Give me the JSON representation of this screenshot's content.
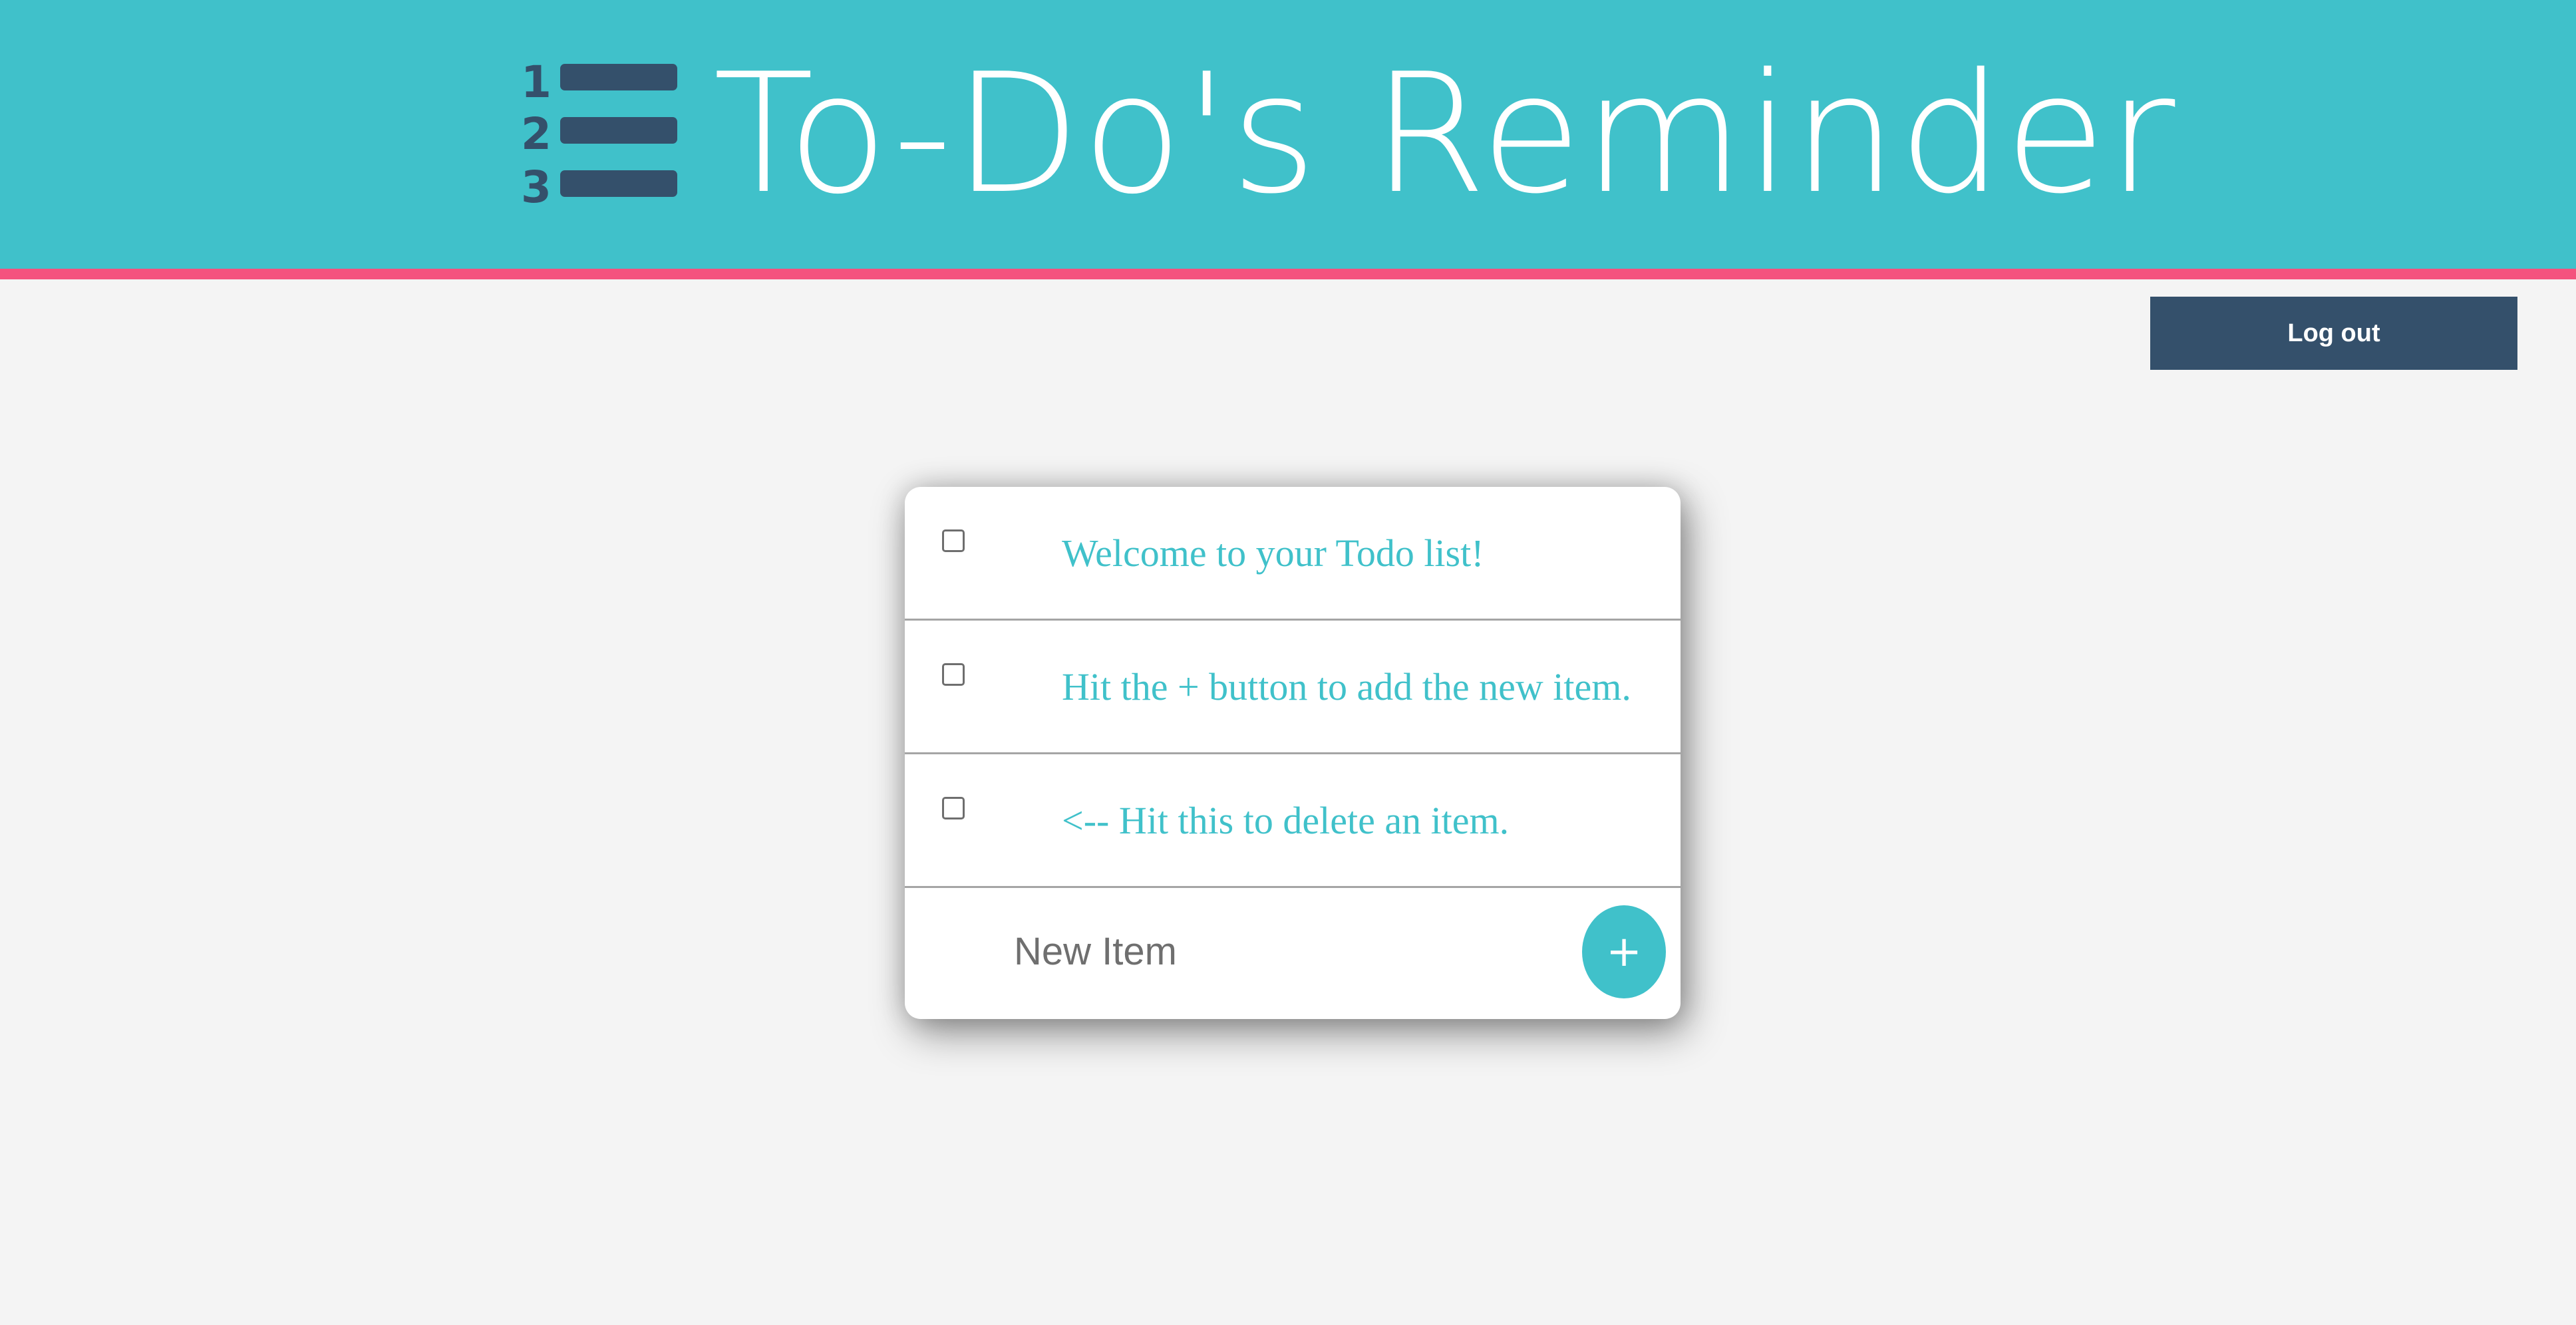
{
  "colors": {
    "header_bg": "#40c1ca",
    "header_border": "#f4527e",
    "page_bg": "#f4f4f4",
    "logout_bg": "#34506b",
    "accent": "#40c1ca",
    "logo_dark": "#34506b"
  },
  "header": {
    "logo_icon": "numbered-list-icon",
    "logo_numbers": [
      "1",
      "2",
      "3"
    ],
    "title": "To-Do's Reminder"
  },
  "logout": {
    "label": "Log out"
  },
  "todo": {
    "items": [
      {
        "text": "Welcome to your Todo list!",
        "checked": false
      },
      {
        "text": "Hit the + button to add the new item.",
        "checked": false
      },
      {
        "text": "<-- Hit this to delete an item.",
        "checked": false
      }
    ],
    "new_item": {
      "placeholder": "New Item",
      "value": ""
    },
    "add_button": {
      "label": "+",
      "icon": "plus-icon"
    }
  }
}
